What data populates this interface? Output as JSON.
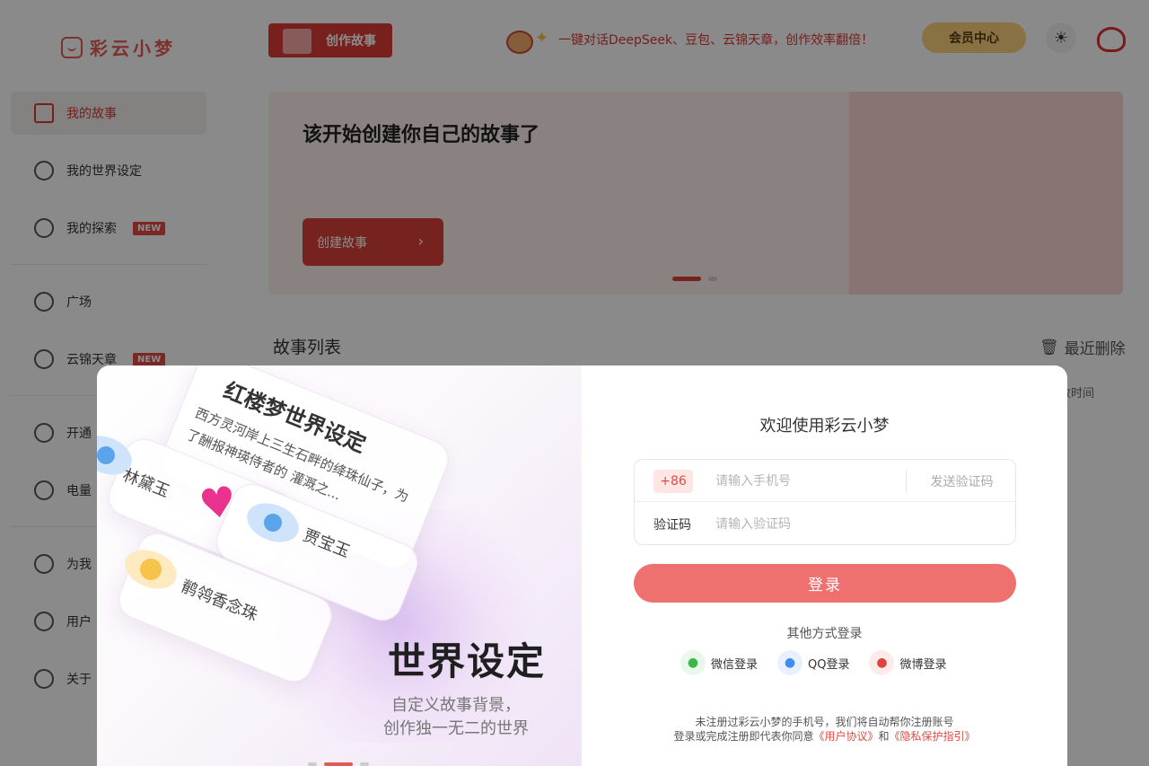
{
  "app": {
    "logo_text": "彩云小梦",
    "create_button": "创作故事",
    "promo_text": "一键对话DeepSeek、豆包、云锦天章，创作效率翻倍！",
    "vip_button": "会员中心"
  },
  "sidebar": {
    "items": [
      {
        "label": "我的故事"
      },
      {
        "label": "我的世界设定"
      },
      {
        "label": "我的探索",
        "badge": "NEW"
      },
      {
        "label": "广场"
      },
      {
        "label": "云锦天章",
        "badge": "NEW"
      },
      {
        "label": "开通"
      },
      {
        "label": "电量"
      },
      {
        "label": "为我"
      },
      {
        "label": "用户"
      },
      {
        "label": "关于"
      }
    ]
  },
  "banner": {
    "title": "该开始创建你自己的故事了",
    "button": "创建故事"
  },
  "story_list": {
    "title": "故事列表",
    "recently_deleted": "最近删除",
    "sort_label": "改时间"
  },
  "modal": {
    "illustration": {
      "card_title": "红楼梦世界设定",
      "card_desc": "西方灵河岸上三生石畔的绛珠仙子，为了酬报神瑛侍者的 灌溉之...",
      "character_1": "林黛玉",
      "character_2": "贾宝玉",
      "character_3": "鹡鸰香念珠",
      "headline": "世界设定",
      "subline_1": "自定义故事背景，",
      "subline_2": "创作独一无二的世界"
    },
    "welcome": "欢迎使用彩云小梦",
    "country_code": "+86",
    "phone_placeholder": "请输入手机号",
    "send_code": "发送验证码",
    "code_label": "验证码",
    "code_placeholder": "请输入验证码",
    "login_button": "登录",
    "other_methods": "其他方式登录",
    "wechat_login": "微信登录",
    "qq_login": "QQ登录",
    "weibo_login": "微博登录",
    "terms_line1": "未注册过彩云小梦的手机号，我们将自动帮你注册账号",
    "terms_line2_prefix": "登录或完成注册即代表你同意",
    "user_agreement": "《用户协议》",
    "terms_and": "和",
    "privacy_policy": "《隐私保护指引》"
  },
  "colors": {
    "accent": "#e04a44",
    "login_button": "#ee7170",
    "vip": "#f7cf7d"
  }
}
